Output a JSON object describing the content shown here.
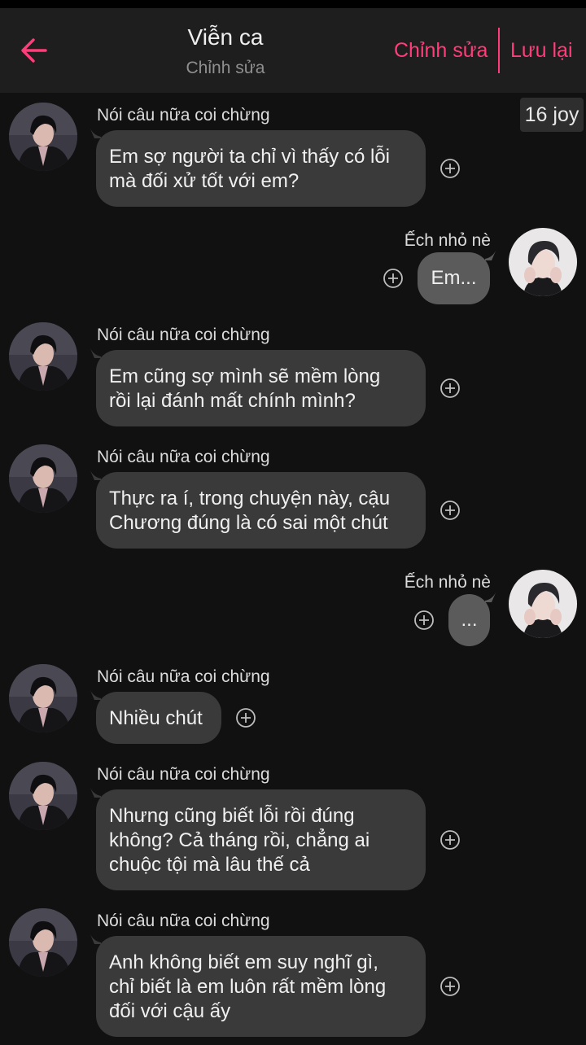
{
  "header": {
    "title": "Viễn ca",
    "subtitle": "Chỉnh sửa",
    "edit_label": "Chỉnh sửa",
    "save_label": "Lưu lại",
    "accent": "#ff3d7a"
  },
  "badge": "16 joy",
  "messages": [
    {
      "side": "left",
      "name": "Nói câu nữa coi chừng",
      "text": "Em sợ người ta chỉ vì thấy có lỗi\nmà đối xử tốt với em?"
    },
    {
      "side": "right",
      "name": "Ếch nhỏ nè",
      "text": "Em..."
    },
    {
      "side": "left",
      "name": "Nói câu nữa coi chừng",
      "text": "Em cũng sợ mình sẽ mềm lòng\nrồi lại đánh mất chính mình?"
    },
    {
      "side": "left",
      "name": "Nói câu nữa coi chừng",
      "text": "Thực ra í, trong chuyện này, cậu\nChương đúng là có sai một chút"
    },
    {
      "side": "right",
      "name": "Ếch nhỏ nè",
      "text": "..."
    },
    {
      "side": "left",
      "name": "Nói câu nữa coi chừng",
      "text": "Nhiều chút"
    },
    {
      "side": "left",
      "name": "Nói câu nữa coi chừng",
      "text": "Nhưng cũng biết lỗi rồi đúng\nkhông? Cả tháng rồi, chẳng ai\nchuộc tội mà lâu thế cả"
    },
    {
      "side": "left",
      "name": "Nói câu nữa coi chừng",
      "text": "Anh không biết em suy nghĩ gì,\nchỉ biết là em luôn rất mềm lòng\nđối với cậu ấy"
    }
  ]
}
